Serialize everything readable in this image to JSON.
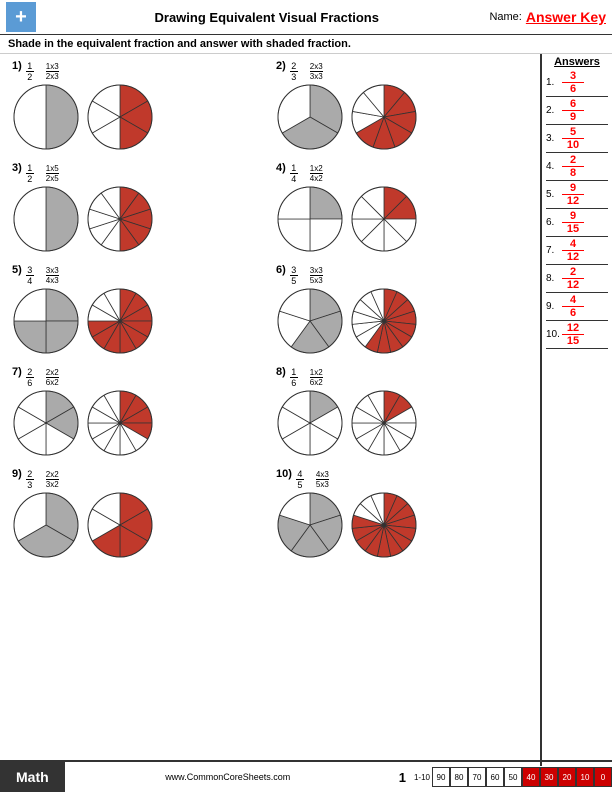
{
  "header": {
    "title": "Drawing Equivalent Visual Fractions",
    "name_label": "Name:",
    "answer_key": "Answer Key"
  },
  "instructions": "Shade in the equivalent fraction and answer with shaded fraction.",
  "answers_title": "Answers",
  "answers": [
    {
      "num": "1.",
      "n": "3",
      "d": "6"
    },
    {
      "num": "2.",
      "n": "6",
      "d": "9"
    },
    {
      "num": "3.",
      "n": "5",
      "d": "10"
    },
    {
      "num": "4.",
      "n": "2",
      "d": "8"
    },
    {
      "num": "5.",
      "n": "9",
      "d": "12"
    },
    {
      "num": "6.",
      "n": "9",
      "d": "15"
    },
    {
      "num": "7.",
      "n": "4",
      "d": "12"
    },
    {
      "num": "8.",
      "n": "2",
      "d": "12"
    },
    {
      "num": "9.",
      "n": "4",
      "d": "6"
    },
    {
      "num": "10.",
      "n": "12",
      "d": "15"
    }
  ],
  "problems": [
    {
      "num": "1)",
      "n1": "1",
      "d1": "2",
      "mult": "1x3",
      "n2": "2x3",
      "orig_slices": 2,
      "orig_shaded": 1,
      "equiv_slices": 6,
      "equiv_shaded": 3
    },
    {
      "num": "2)",
      "n1": "2",
      "d1": "3",
      "mult": "2x3",
      "n2": "3x3",
      "orig_slices": 3,
      "orig_shaded": 2,
      "equiv_slices": 9,
      "equiv_shaded": 6
    },
    {
      "num": "3)",
      "n1": "1",
      "d1": "2",
      "mult": "1x5",
      "n2": "2x5",
      "orig_slices": 2,
      "orig_shaded": 1,
      "equiv_slices": 10,
      "equiv_shaded": 5
    },
    {
      "num": "4)",
      "n1": "1",
      "d1": "4",
      "mult": "1x2",
      "n2": "4x2",
      "orig_slices": 4,
      "orig_shaded": 1,
      "equiv_slices": 8,
      "equiv_shaded": 2
    },
    {
      "num": "5)",
      "n1": "3",
      "d1": "4",
      "mult": "3x3",
      "n2": "4x3",
      "orig_slices": 4,
      "orig_shaded": 3,
      "equiv_slices": 12,
      "equiv_shaded": 9
    },
    {
      "num": "6)",
      "n1": "3",
      "d1": "5",
      "mult": "3x3",
      "n2": "5x3",
      "orig_slices": 5,
      "orig_shaded": 3,
      "equiv_slices": 15,
      "equiv_shaded": 9
    },
    {
      "num": "7)",
      "n1": "2",
      "d1": "6",
      "mult": "2x2",
      "n2": "6x2",
      "orig_slices": 6,
      "orig_shaded": 2,
      "equiv_slices": 12,
      "equiv_shaded": 4
    },
    {
      "num": "8)",
      "n1": "1",
      "d1": "6",
      "mult": "1x2",
      "n2": "6x2",
      "orig_slices": 6,
      "orig_shaded": 1,
      "equiv_slices": 12,
      "equiv_shaded": 2
    },
    {
      "num": "9)",
      "n1": "2",
      "d1": "3",
      "mult": "2x2",
      "n2": "3x2",
      "orig_slices": 3,
      "orig_shaded": 2,
      "equiv_slices": 6,
      "equiv_shaded": 4
    },
    {
      "num": "10)",
      "n1": "4",
      "d1": "5",
      "mult": "4x3",
      "n2": "5x3",
      "orig_slices": 5,
      "orig_shaded": 4,
      "equiv_slices": 15,
      "equiv_shaded": 12
    }
  ],
  "footer": {
    "math_label": "Math",
    "website": "www.CommonCoreSheets.com",
    "page": "1",
    "score_label": "1-10",
    "scores": [
      "90",
      "80",
      "70",
      "60",
      "50",
      "40",
      "30",
      "20",
      "10",
      "0"
    ]
  }
}
